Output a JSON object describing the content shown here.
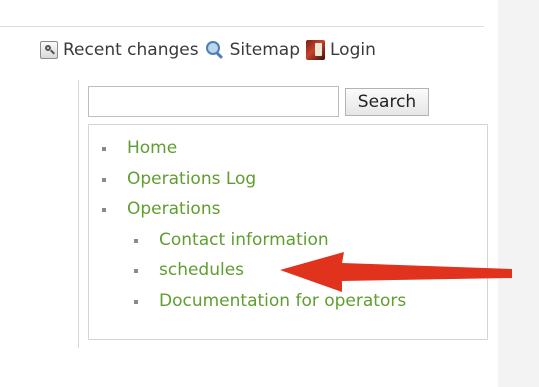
{
  "top_links": {
    "recent_changes": "Recent changes",
    "sitemap": "Sitemap",
    "login": "Login"
  },
  "search": {
    "value": "",
    "button_label": "Search"
  },
  "nav": {
    "items": [
      {
        "label": "Home",
        "level": 1
      },
      {
        "label": "Operations Log",
        "level": 1
      },
      {
        "label": "Operations",
        "level": 1
      },
      {
        "label": "Contact information",
        "level": 2
      },
      {
        "label": "schedules",
        "level": 2
      },
      {
        "label": "Documentation for operators",
        "level": 2
      }
    ]
  },
  "colors": {
    "link": "#5f9e2f",
    "annotation_arrow": "#e0321c"
  },
  "icons": {
    "recent_changes": "magnifier-doc-icon",
    "sitemap": "magnifier-icon",
    "login": "login-door-icon",
    "annotation": "red-arrow-icon"
  }
}
